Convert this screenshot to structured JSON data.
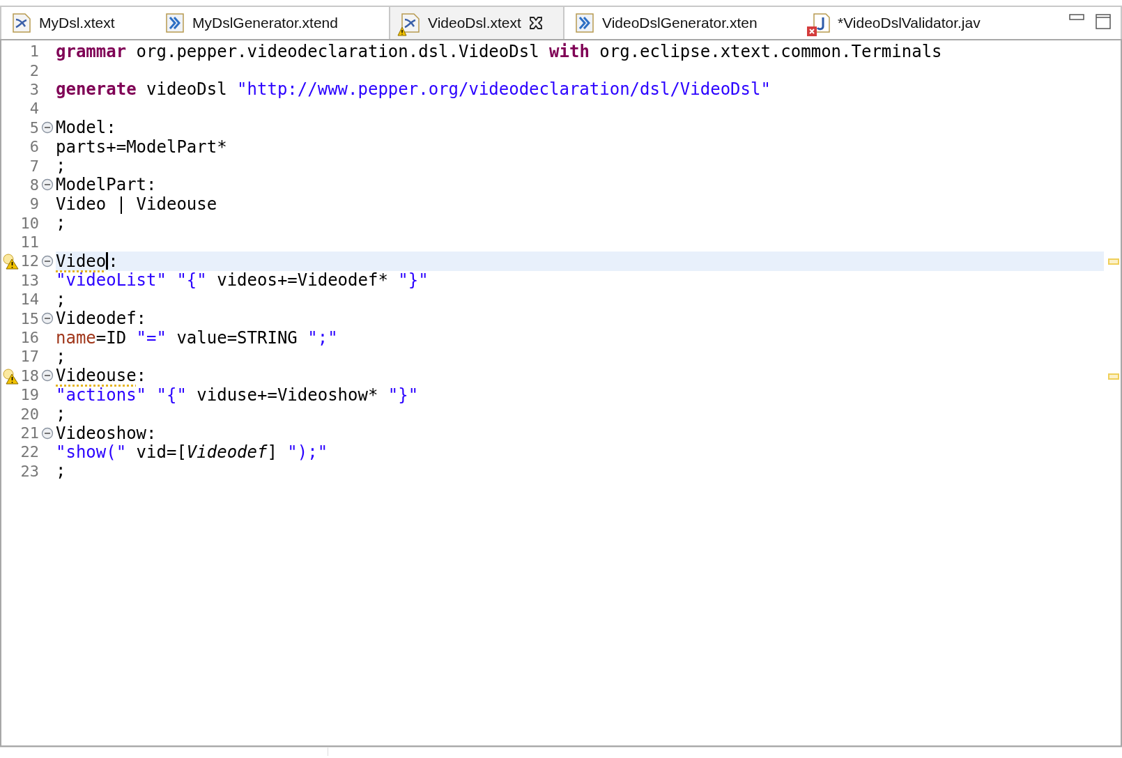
{
  "tabs": [
    {
      "label": "MyDsl.xtext",
      "kind": "xtext",
      "selected": false,
      "warning": false,
      "error": false,
      "closable": false
    },
    {
      "label": "MyDslGenerator.xtend",
      "kind": "xtend",
      "selected": false,
      "warning": false,
      "error": false,
      "closable": false
    },
    {
      "label": "VideoDsl.xtext",
      "kind": "xtext",
      "selected": true,
      "warning": true,
      "error": false,
      "closable": true
    },
    {
      "label": "VideoDslGenerator.xten",
      "kind": "xtend",
      "selected": false,
      "warning": false,
      "error": false,
      "closable": false
    },
    {
      "label": "*VideoDslValidator.jav",
      "kind": "java",
      "selected": false,
      "warning": false,
      "error": true,
      "closable": false
    }
  ],
  "editor": {
    "lines": [
      {
        "number": "1",
        "tokens": [
          {
            "kind": "keyword",
            "text": "grammar"
          },
          {
            "kind": "plain",
            "text": " org.pepper.videodeclaration.dsl.VideoDsl "
          },
          {
            "kind": "keyword",
            "text": "with"
          },
          {
            "kind": "plain",
            "text": " org.eclipse.xtext.common.Terminals"
          }
        ]
      },
      {
        "number": "2"
      },
      {
        "number": "3",
        "tokens": [
          {
            "kind": "keyword",
            "text": "generate"
          },
          {
            "kind": "plain",
            "text": " videoDsl "
          },
          {
            "kind": "string",
            "text": "\"http://www.pepper.org/videodeclaration/dsl/VideoDsl\""
          }
        ]
      },
      {
        "number": "4"
      },
      {
        "number": "5",
        "foldable": true,
        "tokens": [
          {
            "kind": "plain",
            "text": "Model:"
          }
        ]
      },
      {
        "number": "6",
        "tokens": [
          {
            "kind": "plain",
            "text": "parts+=ModelPart*"
          }
        ]
      },
      {
        "number": "7",
        "tokens": [
          {
            "kind": "plain",
            "text": ";"
          }
        ]
      },
      {
        "number": "8",
        "foldable": true,
        "tokens": [
          {
            "kind": "plain",
            "text": "ModelPart:"
          }
        ]
      },
      {
        "number": "9",
        "tokens": [
          {
            "kind": "plain",
            "text": "Video | Videouse"
          }
        ]
      },
      {
        "number": "10",
        "tokens": [
          {
            "kind": "plain",
            "text": ";"
          }
        ]
      },
      {
        "number": "11"
      },
      {
        "number": "12",
        "foldable": true,
        "warning": true,
        "current": true,
        "tokens": [
          {
            "kind": "plain",
            "text": "Video",
            "warning": true,
            "caret": true
          },
          {
            "kind": "plain",
            "text": ":"
          }
        ]
      },
      {
        "number": "13",
        "tokens": [
          {
            "kind": "string",
            "text": "\"videoList\" \"{\""
          },
          {
            "kind": "plain",
            "text": " videos+=Videodef* "
          },
          {
            "kind": "string",
            "text": "\"}\""
          }
        ]
      },
      {
        "number": "14",
        "tokens": [
          {
            "kind": "plain",
            "text": ";"
          }
        ]
      },
      {
        "number": "15",
        "foldable": true,
        "tokens": [
          {
            "kind": "plain",
            "text": "Videodef:"
          }
        ]
      },
      {
        "number": "16",
        "tokens": [
          {
            "kind": "feature",
            "text": "name"
          },
          {
            "kind": "plain",
            "text": "=ID "
          },
          {
            "kind": "string",
            "text": "\"=\""
          },
          {
            "kind": "plain",
            "text": " value=STRING "
          },
          {
            "kind": "string",
            "text": "\";\""
          }
        ]
      },
      {
        "number": "17",
        "tokens": [
          {
            "kind": "plain",
            "text": ";"
          }
        ]
      },
      {
        "number": "18",
        "foldable": true,
        "warning": true,
        "tokens": [
          {
            "kind": "plain",
            "text": "Videouse",
            "warning": true
          },
          {
            "kind": "plain",
            "text": ":"
          }
        ]
      },
      {
        "number": "19",
        "tokens": [
          {
            "kind": "string",
            "text": "\"actions\" \"{\""
          },
          {
            "kind": "plain",
            "text": " viduse+=Videoshow* "
          },
          {
            "kind": "string",
            "text": "\"}\""
          }
        ]
      },
      {
        "number": "20",
        "tokens": [
          {
            "kind": "plain",
            "text": ";"
          }
        ]
      },
      {
        "number": "21",
        "foldable": true,
        "tokens": [
          {
            "kind": "plain",
            "text": "Videoshow:"
          }
        ]
      },
      {
        "number": "22",
        "tokens": [
          {
            "kind": "string",
            "text": "\"show(\""
          },
          {
            "kind": "plain",
            "text": " vid=["
          },
          {
            "kind": "reference",
            "text": "Videodef"
          },
          {
            "kind": "plain",
            "text": "] "
          },
          {
            "kind": "string",
            "text": "\");\""
          }
        ]
      },
      {
        "number": "23",
        "tokens": [
          {
            "kind": "plain",
            "text": ";"
          }
        ]
      }
    ]
  }
}
